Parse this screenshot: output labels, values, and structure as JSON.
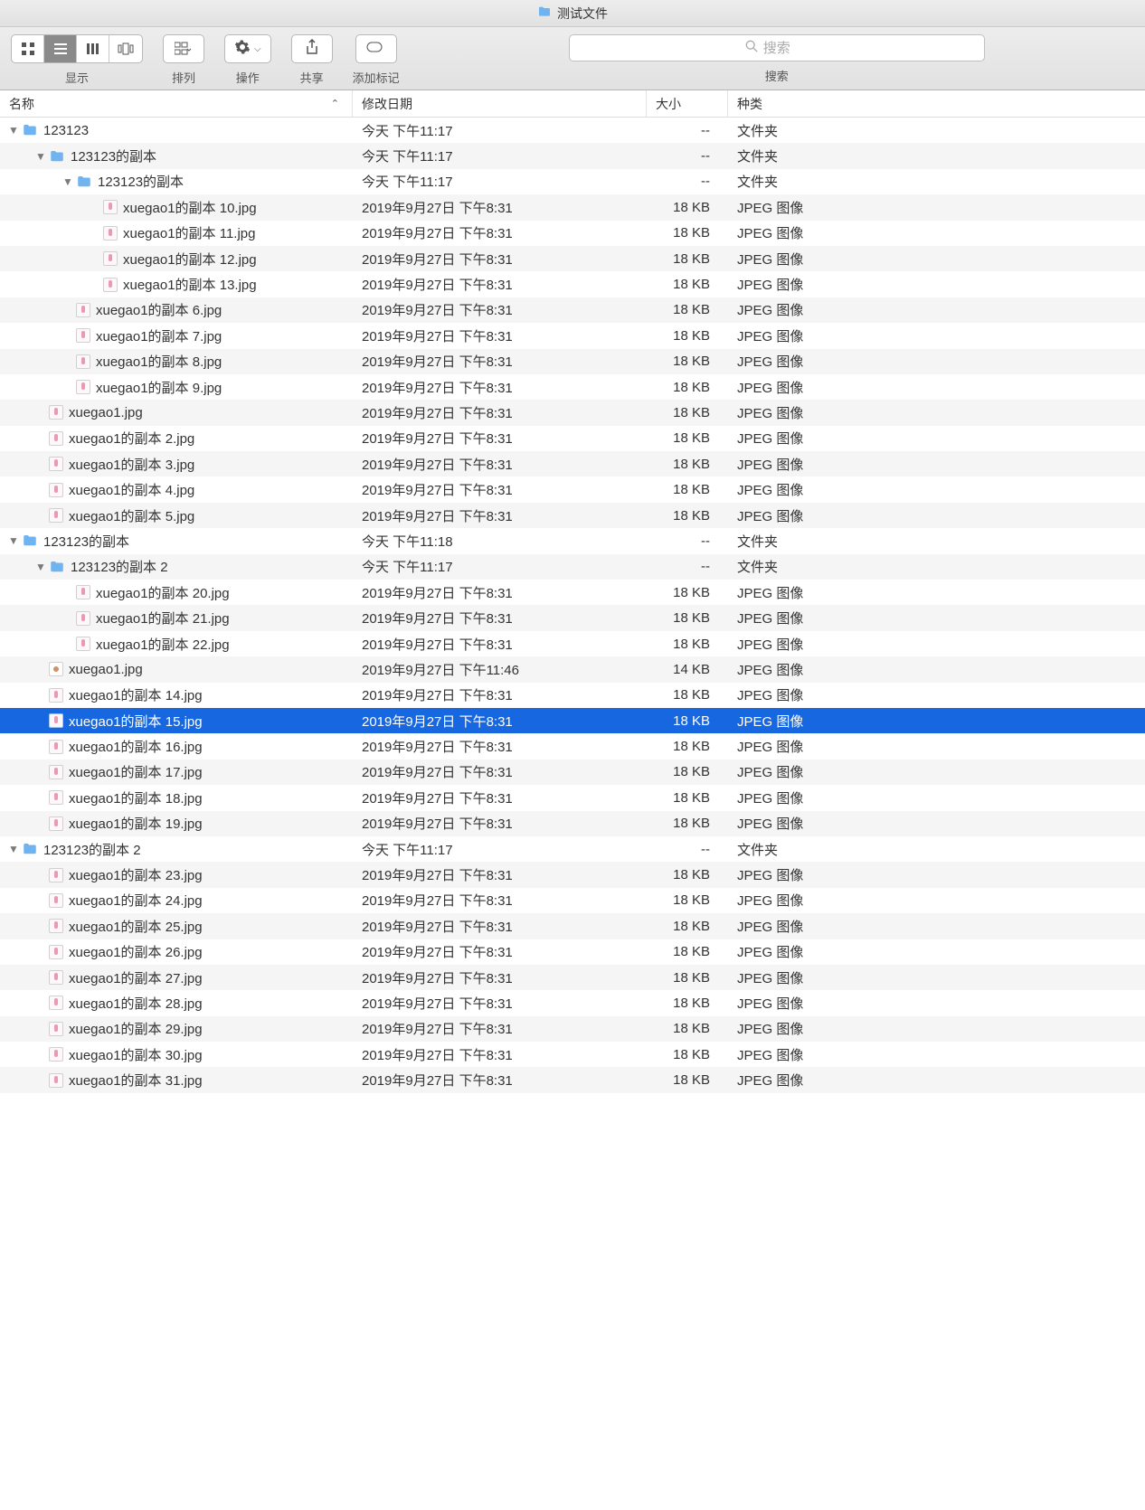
{
  "window": {
    "title": "测试文件"
  },
  "toolbar": {
    "view_label": "显示",
    "arrange_label": "排列",
    "action_label": "操作",
    "share_label": "共享",
    "tag_label": "添加标记",
    "search_label": "搜索",
    "search_placeholder": "搜索"
  },
  "header": {
    "name": "名称",
    "date": "修改日期",
    "size": "大小",
    "kind": "种类"
  },
  "types": {
    "folder": "文件夹",
    "jpeg": "JPEG 图像"
  },
  "dates": {
    "today1117": "今天 下午11:17",
    "today1118": "今天 下午11:18",
    "d831": "2019年9月27日 下午8:31",
    "d1146": "2019年9月27日 下午11:46"
  },
  "sizes": {
    "dash": "--",
    "kb18": "18 KB",
    "kb14": "14 KB"
  },
  "rows": [
    {
      "indent": 0,
      "disc": "down",
      "icon": "folder",
      "name": "123123",
      "date": "today1117",
      "size": "dash",
      "kind": "folder"
    },
    {
      "indent": 1,
      "disc": "down",
      "icon": "folder",
      "name": "123123的副本",
      "date": "today1117",
      "size": "dash",
      "kind": "folder"
    },
    {
      "indent": 2,
      "disc": "down",
      "icon": "folder",
      "name": "123123的副本",
      "date": "today1117",
      "size": "dash",
      "kind": "folder"
    },
    {
      "indent": 3,
      "disc": "",
      "icon": "img",
      "name": "xuegao1的副本 10.jpg",
      "date": "d831",
      "size": "kb18",
      "kind": "jpeg"
    },
    {
      "indent": 3,
      "disc": "",
      "icon": "img",
      "name": "xuegao1的副本 11.jpg",
      "date": "d831",
      "size": "kb18",
      "kind": "jpeg"
    },
    {
      "indent": 3,
      "disc": "",
      "icon": "img",
      "name": "xuegao1的副本 12.jpg",
      "date": "d831",
      "size": "kb18",
      "kind": "jpeg"
    },
    {
      "indent": 3,
      "disc": "",
      "icon": "img",
      "name": "xuegao1的副本 13.jpg",
      "date": "d831",
      "size": "kb18",
      "kind": "jpeg"
    },
    {
      "indent": 2,
      "disc": "",
      "icon": "img",
      "name": "xuegao1的副本 6.jpg",
      "date": "d831",
      "size": "kb18",
      "kind": "jpeg"
    },
    {
      "indent": 2,
      "disc": "",
      "icon": "img",
      "name": "xuegao1的副本 7.jpg",
      "date": "d831",
      "size": "kb18",
      "kind": "jpeg"
    },
    {
      "indent": 2,
      "disc": "",
      "icon": "img",
      "name": "xuegao1的副本 8.jpg",
      "date": "d831",
      "size": "kb18",
      "kind": "jpeg"
    },
    {
      "indent": 2,
      "disc": "",
      "icon": "img",
      "name": "xuegao1的副本 9.jpg",
      "date": "d831",
      "size": "kb18",
      "kind": "jpeg"
    },
    {
      "indent": 1,
      "disc": "",
      "icon": "img",
      "name": "xuegao1.jpg",
      "date": "d831",
      "size": "kb18",
      "kind": "jpeg"
    },
    {
      "indent": 1,
      "disc": "",
      "icon": "img",
      "name": "xuegao1的副本 2.jpg",
      "date": "d831",
      "size": "kb18",
      "kind": "jpeg"
    },
    {
      "indent": 1,
      "disc": "",
      "icon": "img",
      "name": "xuegao1的副本 3.jpg",
      "date": "d831",
      "size": "kb18",
      "kind": "jpeg"
    },
    {
      "indent": 1,
      "disc": "",
      "icon": "img",
      "name": "xuegao1的副本 4.jpg",
      "date": "d831",
      "size": "kb18",
      "kind": "jpeg"
    },
    {
      "indent": 1,
      "disc": "",
      "icon": "img",
      "name": "xuegao1的副本 5.jpg",
      "date": "d831",
      "size": "kb18",
      "kind": "jpeg"
    },
    {
      "indent": 0,
      "disc": "down",
      "icon": "folder",
      "name": "123123的副本",
      "date": "today1118",
      "size": "dash",
      "kind": "folder"
    },
    {
      "indent": 1,
      "disc": "down",
      "icon": "folder",
      "name": "123123的副本 2",
      "date": "today1117",
      "size": "dash",
      "kind": "folder"
    },
    {
      "indent": 2,
      "disc": "",
      "icon": "img",
      "name": "xuegao1的副本 20.jpg",
      "date": "d831",
      "size": "kb18",
      "kind": "jpeg"
    },
    {
      "indent": 2,
      "disc": "",
      "icon": "img",
      "name": "xuegao1的副本 21.jpg",
      "date": "d831",
      "size": "kb18",
      "kind": "jpeg"
    },
    {
      "indent": 2,
      "disc": "",
      "icon": "img",
      "name": "xuegao1的副本 22.jpg",
      "date": "d831",
      "size": "kb18",
      "kind": "jpeg"
    },
    {
      "indent": 1,
      "disc": "",
      "icon": "img2",
      "name": "xuegao1.jpg",
      "date": "d1146",
      "size": "kb14",
      "kind": "jpeg"
    },
    {
      "indent": 1,
      "disc": "",
      "icon": "img",
      "name": "xuegao1的副本 14.jpg",
      "date": "d831",
      "size": "kb18",
      "kind": "jpeg"
    },
    {
      "indent": 1,
      "disc": "",
      "icon": "img",
      "name": "xuegao1的副本 15.jpg",
      "date": "d831",
      "size": "kb18",
      "kind": "jpeg",
      "selected": true
    },
    {
      "indent": 1,
      "disc": "",
      "icon": "img",
      "name": "xuegao1的副本 16.jpg",
      "date": "d831",
      "size": "kb18",
      "kind": "jpeg"
    },
    {
      "indent": 1,
      "disc": "",
      "icon": "img",
      "name": "xuegao1的副本 17.jpg",
      "date": "d831",
      "size": "kb18",
      "kind": "jpeg"
    },
    {
      "indent": 1,
      "disc": "",
      "icon": "img",
      "name": "xuegao1的副本 18.jpg",
      "date": "d831",
      "size": "kb18",
      "kind": "jpeg"
    },
    {
      "indent": 1,
      "disc": "",
      "icon": "img",
      "name": "xuegao1的副本 19.jpg",
      "date": "d831",
      "size": "kb18",
      "kind": "jpeg"
    },
    {
      "indent": 0,
      "disc": "down",
      "icon": "folder",
      "name": "123123的副本 2",
      "date": "today1117",
      "size": "dash",
      "kind": "folder"
    },
    {
      "indent": 1,
      "disc": "",
      "icon": "img",
      "name": "xuegao1的副本 23.jpg",
      "date": "d831",
      "size": "kb18",
      "kind": "jpeg"
    },
    {
      "indent": 1,
      "disc": "",
      "icon": "img",
      "name": "xuegao1的副本 24.jpg",
      "date": "d831",
      "size": "kb18",
      "kind": "jpeg"
    },
    {
      "indent": 1,
      "disc": "",
      "icon": "img",
      "name": "xuegao1的副本 25.jpg",
      "date": "d831",
      "size": "kb18",
      "kind": "jpeg"
    },
    {
      "indent": 1,
      "disc": "",
      "icon": "img",
      "name": "xuegao1的副本 26.jpg",
      "date": "d831",
      "size": "kb18",
      "kind": "jpeg"
    },
    {
      "indent": 1,
      "disc": "",
      "icon": "img",
      "name": "xuegao1的副本 27.jpg",
      "date": "d831",
      "size": "kb18",
      "kind": "jpeg"
    },
    {
      "indent": 1,
      "disc": "",
      "icon": "img",
      "name": "xuegao1的副本 28.jpg",
      "date": "d831",
      "size": "kb18",
      "kind": "jpeg"
    },
    {
      "indent": 1,
      "disc": "",
      "icon": "img",
      "name": "xuegao1的副本 29.jpg",
      "date": "d831",
      "size": "kb18",
      "kind": "jpeg"
    },
    {
      "indent": 1,
      "disc": "",
      "icon": "img",
      "name": "xuegao1的副本 30.jpg",
      "date": "d831",
      "size": "kb18",
      "kind": "jpeg"
    },
    {
      "indent": 1,
      "disc": "",
      "icon": "img",
      "name": "xuegao1的副本 31.jpg",
      "date": "d831",
      "size": "kb18",
      "kind": "jpeg"
    }
  ]
}
